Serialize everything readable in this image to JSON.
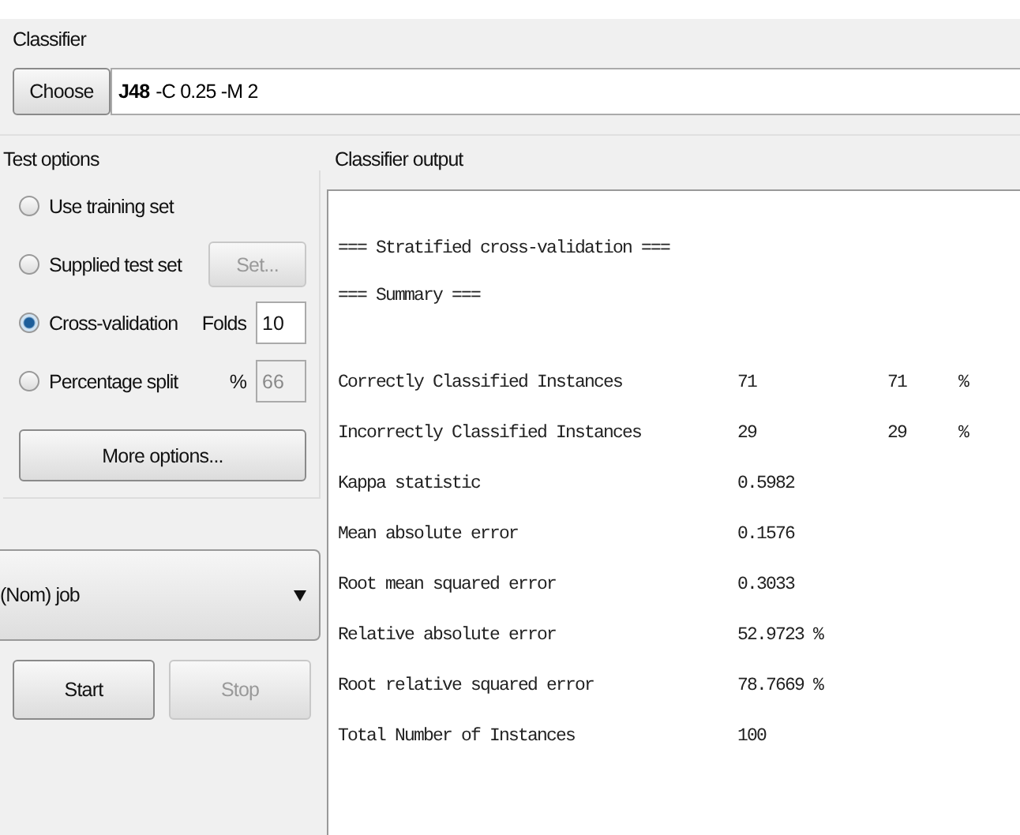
{
  "classifier": {
    "title": "Classifier",
    "choose_button": "Choose",
    "name": "J48",
    "options": "-C 0.25 -M 2"
  },
  "test_options": {
    "title": "Test options",
    "options": [
      {
        "label": "Use training set",
        "selected": false
      },
      {
        "label": "Supplied test set",
        "selected": false,
        "kind": "button",
        "control": "Set...",
        "disabled": true
      },
      {
        "label": "Cross-validation",
        "selected": true,
        "kind": "field",
        "field_label": "Folds",
        "value": "10",
        "disabled": false
      },
      {
        "label": "Percentage split",
        "selected": false,
        "kind": "field",
        "field_label": "%",
        "value": "66",
        "disabled": true
      }
    ],
    "more_button": "More options..."
  },
  "class_select": {
    "value": "(Nom) job"
  },
  "actions": [
    {
      "label": "Start",
      "disabled": false
    },
    {
      "label": "Stop",
      "disabled": true
    }
  ],
  "output": {
    "title": "Classifier output",
    "header_lines": [
      "=== Stratified cross-validation ===",
      "=== Summary ==="
    ],
    "rows": [
      {
        "label": "Correctly Classified Instances",
        "value": "71",
        "percent": "71",
        "percent_sign": "%"
      },
      {
        "label": "Incorrectly Classified Instances",
        "value": "29",
        "percent": "29",
        "percent_sign": "%"
      },
      {
        "label": "Kappa statistic",
        "value": "0.5982"
      },
      {
        "label": "Mean absolute error",
        "value": "0.1576"
      },
      {
        "label": "Root mean squared error",
        "value": "0.3033"
      },
      {
        "label": "Relative absolute error",
        "value": "52.9723 %"
      },
      {
        "label": "Root relative squared error",
        "value": "78.7669 %"
      },
      {
        "label": "Total Number of Instances",
        "value": "100"
      }
    ]
  }
}
